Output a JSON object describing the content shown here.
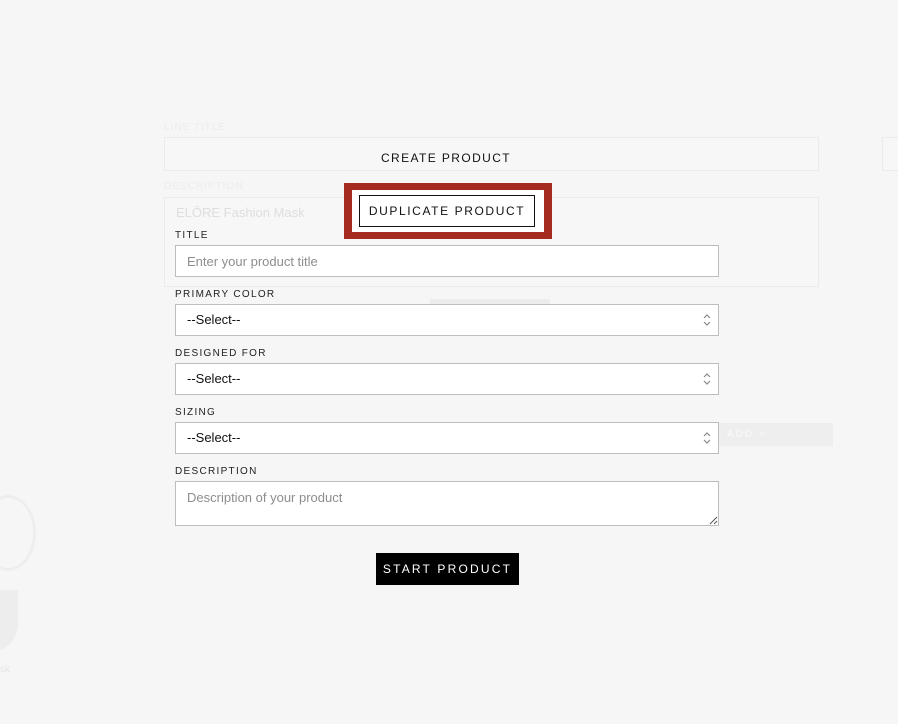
{
  "background": {
    "line_title_label": "LINE TITLE",
    "description_label": "DESCRIPTION",
    "description_value": "ELŌRE Fashion Mask",
    "add_button": "ADD +",
    "corner_text": "sk"
  },
  "tabs": {
    "create": "CREATE PRODUCT",
    "duplicate": "DUPLICATE PRODUCT"
  },
  "form": {
    "title": {
      "label": "TITLE",
      "placeholder": "Enter your product title"
    },
    "primary_color": {
      "label": "PRIMARY COLOR",
      "selected": "--Select--"
    },
    "designed_for": {
      "label": "DESIGNED FOR",
      "selected": "--Select--"
    },
    "sizing": {
      "label": "SIZING",
      "selected": "--Select--"
    },
    "description": {
      "label": "DESCRIPTION",
      "placeholder": "Description of your product"
    },
    "submit_label": "START PRODUCT"
  },
  "colors": {
    "highlight": "#a52a1f",
    "button_bg": "#000000",
    "page_bg": "#f6f6f6"
  }
}
